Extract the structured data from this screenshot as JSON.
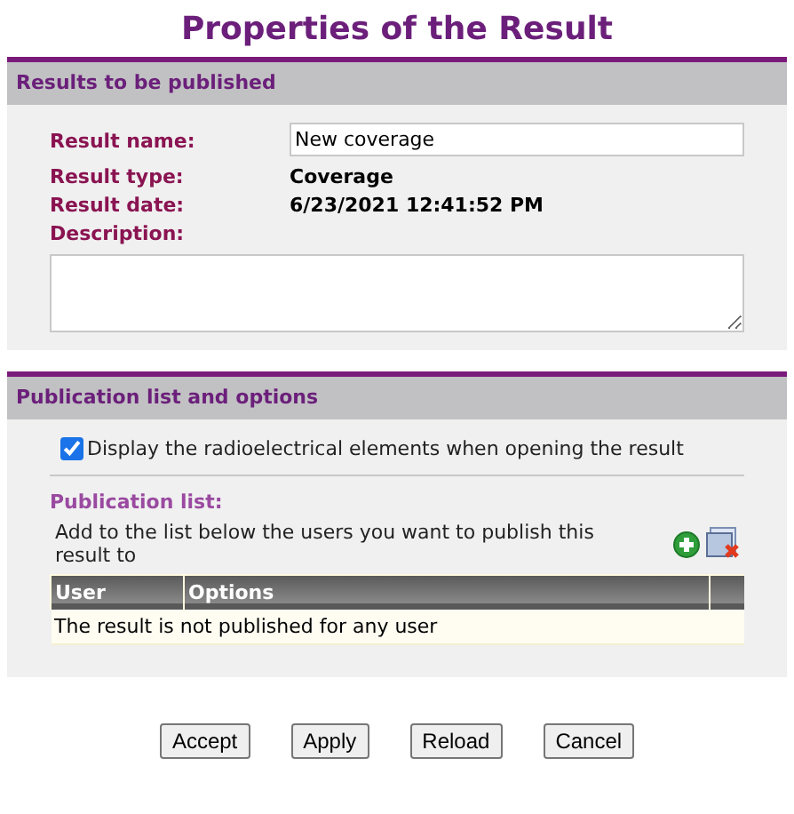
{
  "title": "Properties of the Result",
  "results_section": {
    "header": "Results to be published",
    "fields": [
      {
        "kind": "input",
        "label": "Result name:",
        "value": "New coverage"
      },
      {
        "kind": "text",
        "label": "Result type:",
        "value": "Coverage"
      },
      {
        "kind": "text",
        "label": "Result date:",
        "value": "6/23/2021 12:41:52 PM"
      },
      {
        "kind": "textarea",
        "label": "Description:"
      }
    ]
  },
  "publication_section": {
    "header": "Publication list and options",
    "option": {
      "label": "Display the radioelectrical elements when opening the result",
      "checked": true
    },
    "list_title": "Publication list:",
    "hint": "Add to the list below the users you want to publish this result to",
    "table": {
      "columns": [
        "User",
        "Options"
      ],
      "empty_message": "The result is not published for any user"
    }
  },
  "buttons": [
    "Accept",
    "Apply",
    "Reload",
    "Cancel"
  ]
}
